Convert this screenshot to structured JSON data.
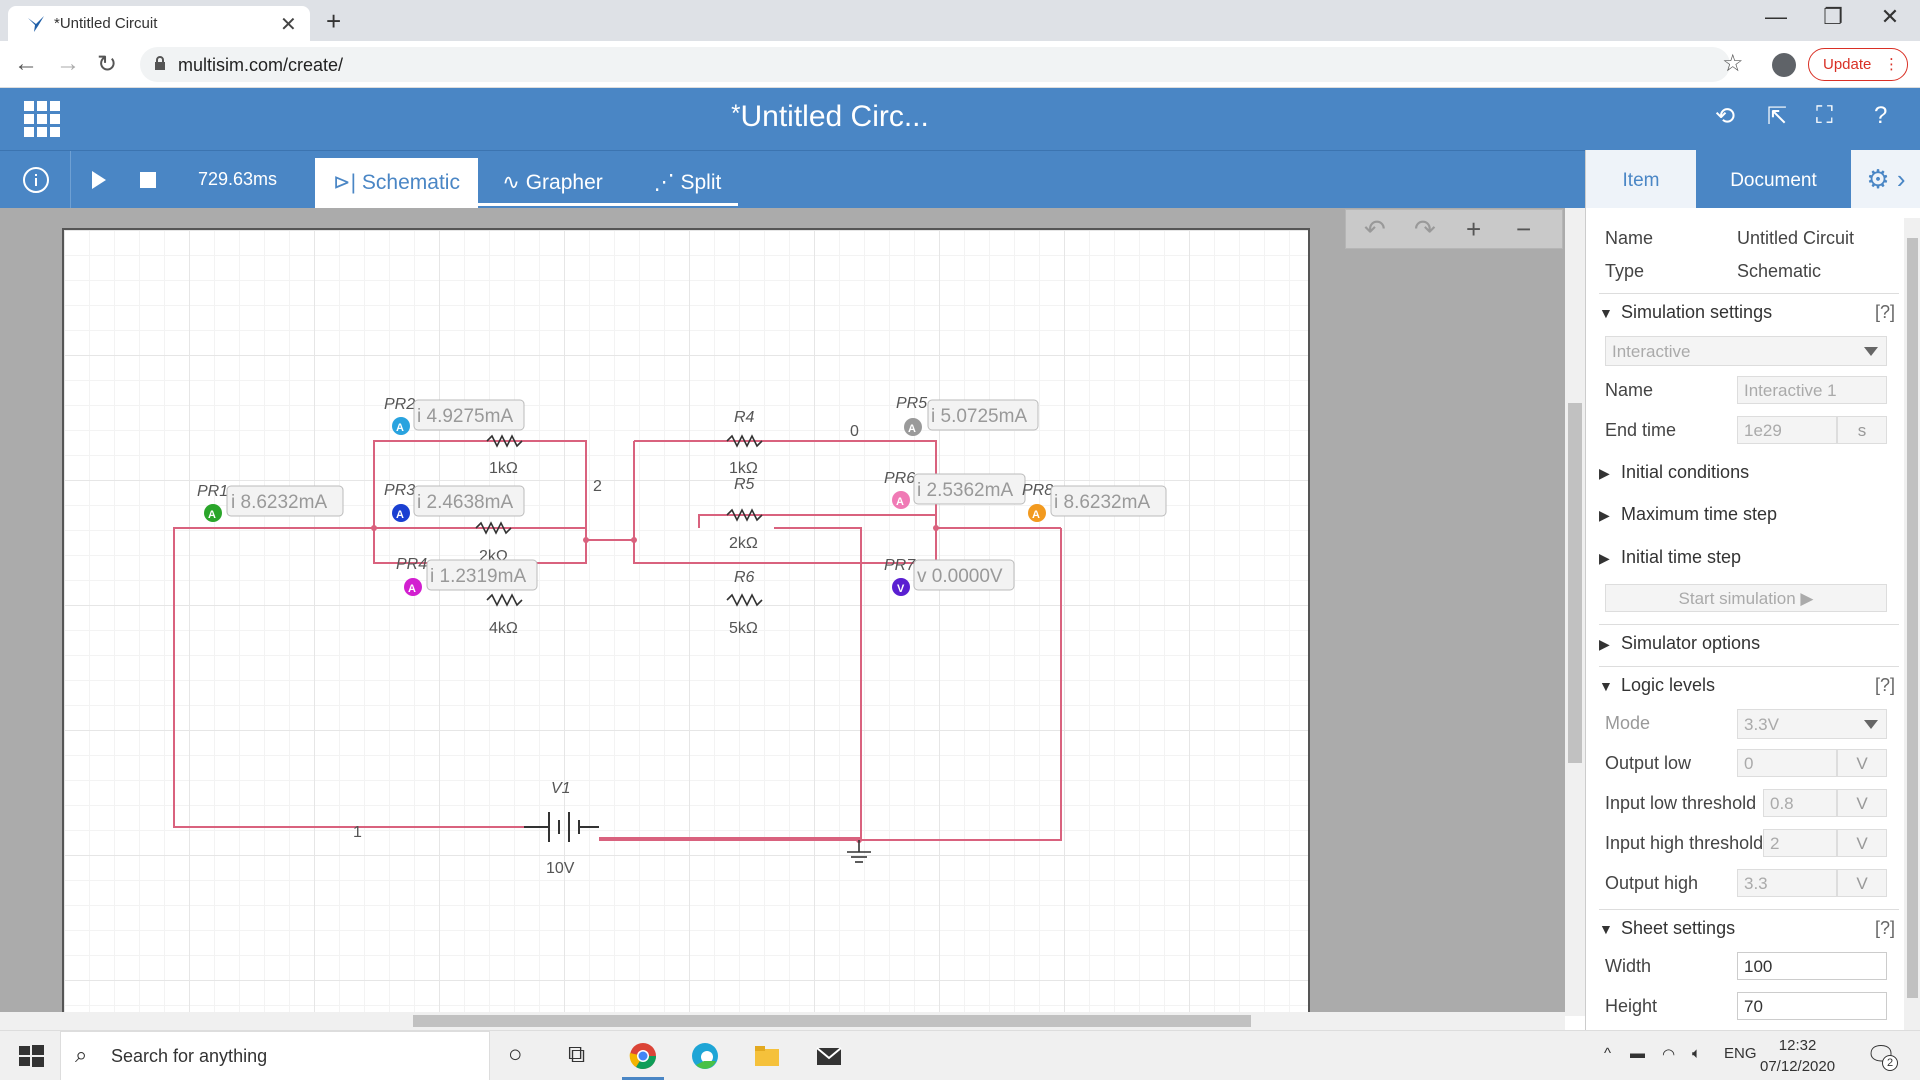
{
  "browser": {
    "tab_title": "*Untitled Circuit",
    "url": "multisim.com/create/",
    "update_label": "Update"
  },
  "app": {
    "title": "Untitled Circ...",
    "title_prefix": "*"
  },
  "toolbar": {
    "time": "729.63ms",
    "tabs": [
      {
        "label": "Schematic"
      },
      {
        "label": "Grapher"
      },
      {
        "label": "Split"
      }
    ]
  },
  "circuit": {
    "nodes": {
      "n0": "0",
      "n1": "1",
      "n2": "2"
    },
    "components": {
      "r_top_left_value": "1kΩ",
      "r_mid_left_value": "2kΩ",
      "r_bot_left_value": "4kΩ",
      "r4_name": "R4",
      "r4_value": "1kΩ",
      "r5_name": "R5",
      "r5_value": "2kΩ",
      "r6_name": "R6",
      "r6_value": "5kΩ",
      "v1_name": "V1",
      "v1_value": "10V"
    },
    "probes": [
      {
        "name": "PR1",
        "type": "A",
        "reading": "i 8.6232mA",
        "color": "#2aa52a"
      },
      {
        "name": "PR2",
        "type": "A",
        "reading": "i 4.9275mA",
        "color": "#29a3df"
      },
      {
        "name": "PR3",
        "type": "A",
        "reading": "i 2.4638mA",
        "color": "#1a3fd1"
      },
      {
        "name": "PR4",
        "type": "A",
        "reading": "i 1.2319mA",
        "color": "#d21fd0"
      },
      {
        "name": "PR5",
        "type": "A",
        "reading": "i 5.0725mA",
        "color": "#9a9a9a"
      },
      {
        "name": "PR6",
        "type": "A",
        "reading": "i 2.5362mA",
        "color": "#f07ab5"
      },
      {
        "name": "PR7",
        "type": "V",
        "reading": "v 0.0000V",
        "color": "#5a1fd1"
      },
      {
        "name": "PR8",
        "type": "A",
        "reading": "i 8.6232mA",
        "color": "#f29a1f"
      }
    ],
    "wire_color": "#d9627e"
  },
  "panel": {
    "tabs": {
      "item": "Item",
      "document": "Document"
    },
    "name_label": "Name",
    "name_value": "Untitled Circuit",
    "type_label": "Type",
    "type_value": "Schematic",
    "sim_settings": "Simulation settings",
    "help": "[?]",
    "sim_mode": "Interactive",
    "sim_name_label": "Name",
    "sim_name_value": "Interactive 1",
    "end_time_label": "End time",
    "end_time_value": "1e29",
    "end_time_unit": "s",
    "initial_conditions": "Initial conditions",
    "max_time_step": "Maximum time step",
    "initial_time_step": "Initial time step",
    "start_simulation": "Start simulation ▶",
    "simulator_options": "Simulator options",
    "logic_levels": "Logic levels",
    "mode_label": "Mode",
    "mode_value": "3.3V",
    "output_low_label": "Output low",
    "output_low_value": "0",
    "input_low_label": "Input low threshold",
    "input_low_value": "0.8",
    "input_high_label": "Input high threshold",
    "input_high_value": "2",
    "output_high_label": "Output high",
    "output_high_value": "3.3",
    "unit_v": "V",
    "sheet_settings": "Sheet settings",
    "width_label": "Width",
    "width_value": "100",
    "height_label": "Height",
    "height_value": "70"
  },
  "taskbar": {
    "search_placeholder": "Search for anything",
    "lang": "ENG",
    "time": "12:32",
    "date": "07/12/2020",
    "notifications": "2"
  }
}
